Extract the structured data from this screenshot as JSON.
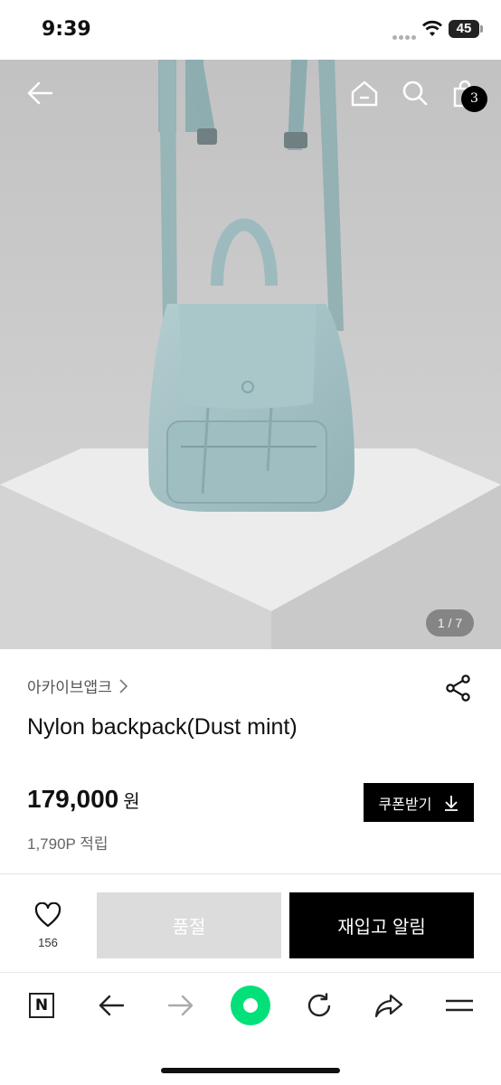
{
  "status_bar": {
    "time": "9:39",
    "battery": "45"
  },
  "header": {
    "cart_count": "3"
  },
  "gallery": {
    "counter": "1 / 7"
  },
  "product": {
    "brand": "아카이브앱크",
    "name": "Nylon backpack(Dust mint)",
    "price": "179,000",
    "currency": "원",
    "points": "1,790P 적립",
    "coupon_label": "쿠폰받기"
  },
  "actions": {
    "like_count": "156",
    "soldout_label": "품절",
    "restock_label": "재입고 알림"
  },
  "icons": {
    "back": "arrow-left-icon",
    "home": "home-icon",
    "search": "search-icon",
    "cart": "bag-icon",
    "share": "share-icon",
    "like": "heart-icon",
    "coupon": "download-icon"
  },
  "colors": {
    "product_mint": "#a6c3c6",
    "browser_green": "#03e07a",
    "primary_black": "#000000",
    "soldout_gray": "#dcdcdc"
  }
}
